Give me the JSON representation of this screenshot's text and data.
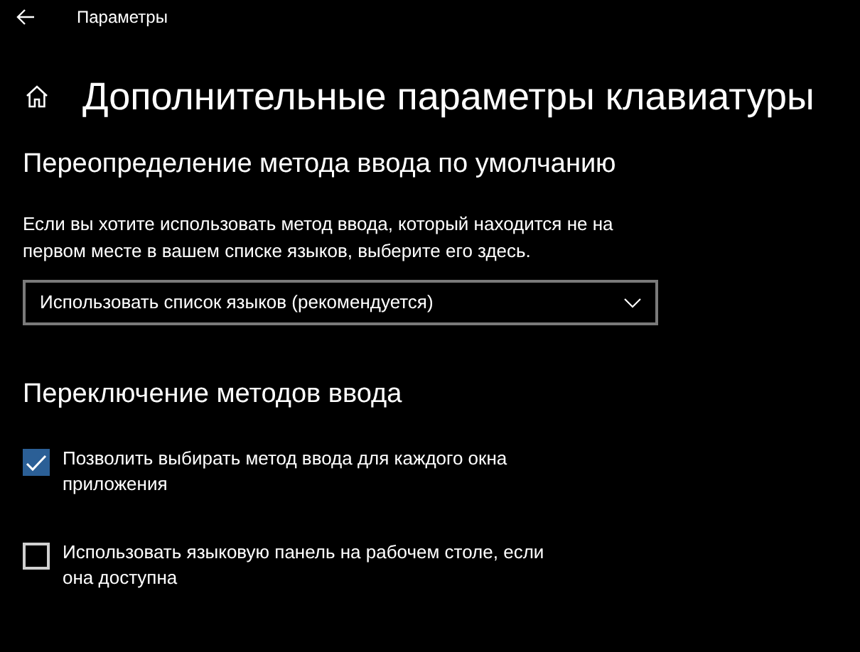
{
  "window": {
    "title": "Параметры"
  },
  "page_title": "Дополнительные параметры клавиатуры",
  "sections": [
    {
      "heading": "Переопределение метода ввода по умолчанию",
      "description": "Если вы хотите использовать метод ввода, который находится не на первом месте в вашем списке языков, выберите его здесь.",
      "dropdown": {
        "value": "Использовать список языков (рекомендуется)"
      }
    },
    {
      "heading": "Переключение методов ввода",
      "checkboxes": [
        {
          "label": "Позволить выбирать метод ввода для каждого окна приложения",
          "checked": true
        },
        {
          "label": "Использовать языковую панель на рабочем столе, если она доступна",
          "checked": false
        }
      ]
    }
  ]
}
